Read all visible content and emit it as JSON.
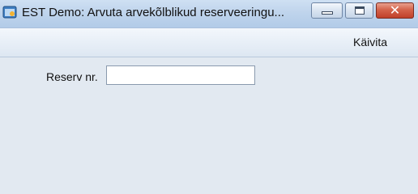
{
  "window": {
    "title": "EST Demo: Arvuta arvekõlblikud reserveeringu...",
    "app_icon": "app-window-icon",
    "controls": [
      "minimize-icon",
      "maximize-icon",
      "close-icon"
    ],
    "close_symbol": "✕"
  },
  "toolbar": {
    "run_label": "Käivita"
  },
  "form": {
    "reserv_label": "Reserv nr.",
    "reserv_value": ""
  },
  "colors": {
    "background": "#e2e9f1",
    "close_button": "#c0402a"
  }
}
